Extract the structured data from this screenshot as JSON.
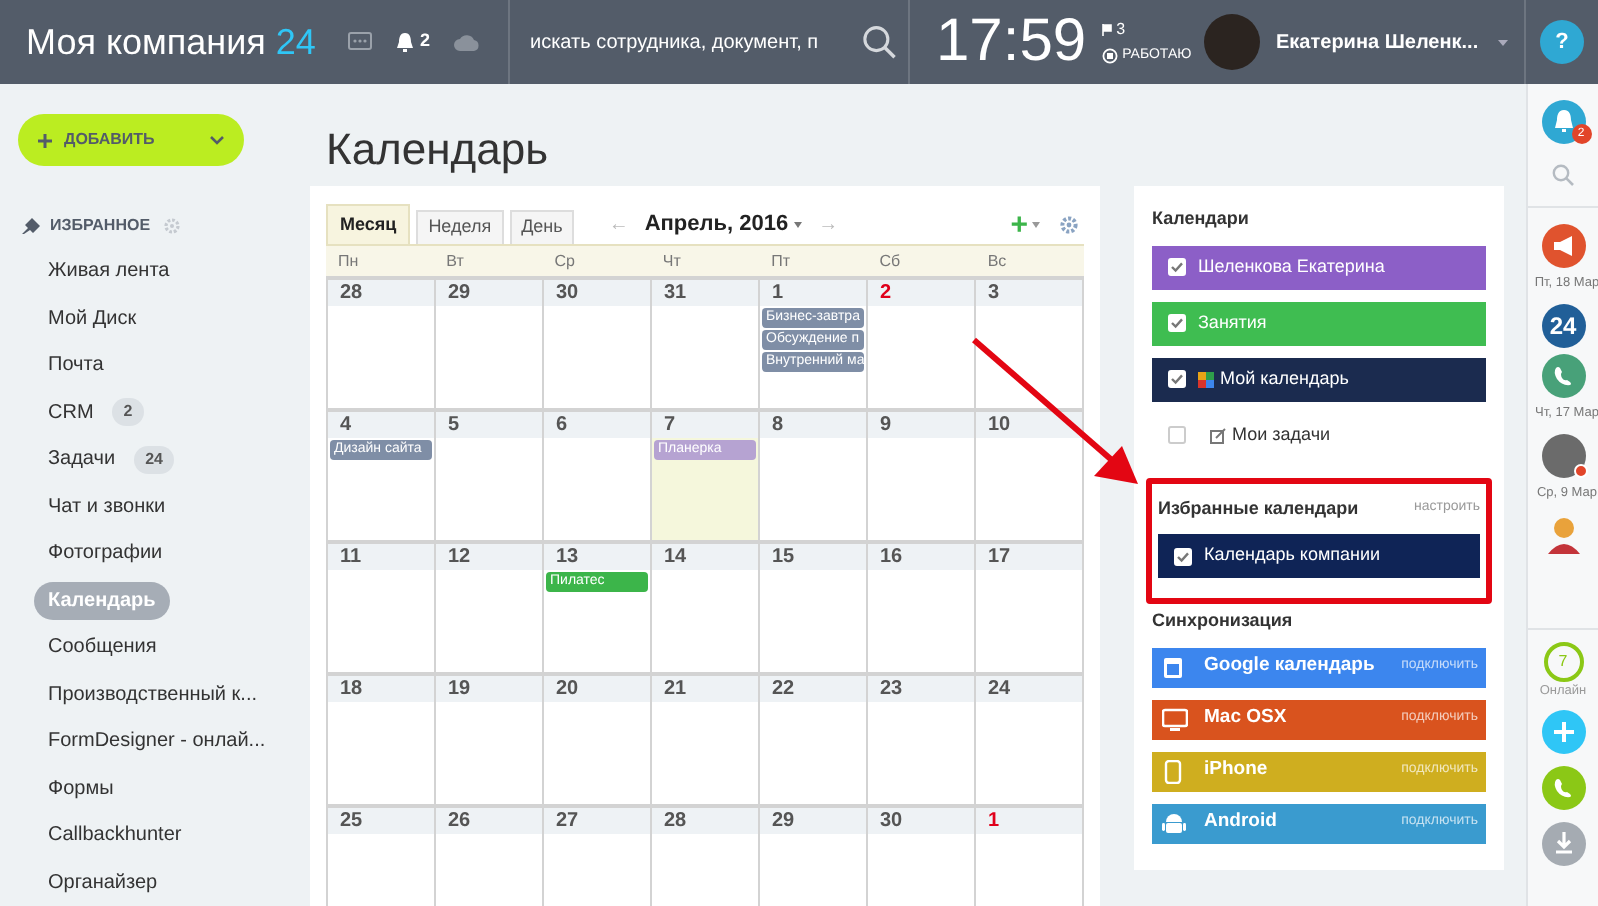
{
  "header": {
    "logo": "Моя компания",
    "logo_number": "24",
    "notifications": "2",
    "search": {
      "placeholder": "искать сотрудника, документ, п"
    },
    "clock": "17:59",
    "flags": "3",
    "status": "РАБОТАЮ",
    "user": "Екатерина Шеленк...",
    "help": "?"
  },
  "sidebar": {
    "add_button": "ДОБАВИТЬ",
    "section": "ИЗБРАННОЕ",
    "items": [
      {
        "label": "Живая лента",
        "selected": false
      },
      {
        "label": "Мой Диск",
        "selected": false
      },
      {
        "label": "Почта",
        "selected": false
      },
      {
        "label": "CRM",
        "badge": "2",
        "selected": false
      },
      {
        "label": "Задачи",
        "badge": "24",
        "selected": false
      },
      {
        "label": "Чат и звонки",
        "selected": false
      },
      {
        "label": "Фотографии",
        "selected": false
      },
      {
        "label": "Календарь",
        "selected": true
      },
      {
        "label": "Сообщения",
        "selected": false
      },
      {
        "label": "Производственный к...",
        "selected": false
      },
      {
        "label": "FormDesigner - онлай...",
        "selected": false
      },
      {
        "label": "Формы",
        "selected": false
      },
      {
        "label": "Callbackhunter",
        "selected": false
      },
      {
        "label": "Органайзер",
        "selected": false
      }
    ]
  },
  "page_title": "Календарь",
  "calendar": {
    "tabs": [
      {
        "label": "Месяц",
        "selected": true
      },
      {
        "label": "Неделя",
        "selected": false
      },
      {
        "label": "День",
        "selected": false
      }
    ],
    "prev": "←",
    "month": "Апрель, 2016",
    "next": "→",
    "add": "+",
    "weekdays": [
      "Пн",
      "Вт",
      "Ср",
      "Чт",
      "Пт",
      "Сб",
      "Вс"
    ],
    "weeks": [
      [
        {
          "day": "28",
          "red": false,
          "today": false
        },
        {
          "day": "29",
          "red": false,
          "today": false
        },
        {
          "day": "30",
          "red": false,
          "today": false
        },
        {
          "day": "31",
          "red": false,
          "today": false
        },
        {
          "day": "1",
          "red": false,
          "today": false,
          "events": [
            {
              "title": "Бизнес-завтра",
              "color": "#7f8ea6"
            },
            {
              "title": "Обсуждение п",
              "color": "#7f8ea6"
            },
            {
              "title": "Внутренний ма",
              "color": "#7f8ea6"
            }
          ]
        },
        {
          "day": "2",
          "red": true,
          "today": false
        },
        {
          "day": "3",
          "red": false,
          "today": false
        }
      ],
      [
        {
          "day": "4",
          "red": false,
          "today": false,
          "events": [
            {
              "title": "Дизайн сайта",
              "color": "#7f8ea6"
            }
          ]
        },
        {
          "day": "5",
          "red": false,
          "today": false
        },
        {
          "day": "6",
          "red": false,
          "today": false
        },
        {
          "day": "7",
          "red": false,
          "today": true,
          "events": [
            {
              "title": "Планерка",
              "color": "#b6a3d2"
            }
          ]
        },
        {
          "day": "8",
          "red": false,
          "today": false
        },
        {
          "day": "9",
          "red": false,
          "today": false
        },
        {
          "day": "10",
          "red": false,
          "today": false
        }
      ],
      [
        {
          "day": "11",
          "red": false,
          "today": false
        },
        {
          "day": "12",
          "red": false,
          "today": false
        },
        {
          "day": "13",
          "red": false,
          "today": false,
          "events": [
            {
              "title": "Пилатес",
              "color": "#3cb54a"
            }
          ]
        },
        {
          "day": "14",
          "red": false,
          "today": false
        },
        {
          "day": "15",
          "red": false,
          "today": false
        },
        {
          "day": "16",
          "red": false,
          "today": false
        },
        {
          "day": "17",
          "red": false,
          "today": false
        }
      ],
      [
        {
          "day": "18",
          "red": false,
          "today": false
        },
        {
          "day": "19",
          "red": false,
          "today": false
        },
        {
          "day": "20",
          "red": false,
          "today": false
        },
        {
          "day": "21",
          "red": false,
          "today": false
        },
        {
          "day": "22",
          "red": false,
          "today": false
        },
        {
          "day": "23",
          "red": false,
          "today": false
        },
        {
          "day": "24",
          "red": false,
          "today": false
        }
      ],
      [
        {
          "day": "25",
          "red": false,
          "today": false
        },
        {
          "day": "26",
          "red": false,
          "today": false
        },
        {
          "day": "27",
          "red": false,
          "today": false
        },
        {
          "day": "28",
          "red": false,
          "today": false
        },
        {
          "day": "29",
          "red": false,
          "today": false
        },
        {
          "day": "30",
          "red": false,
          "today": false
        },
        {
          "day": "1",
          "red": true,
          "today": false
        }
      ]
    ]
  },
  "calendars_panel": {
    "title": "Календари",
    "items": [
      {
        "kind": "colored",
        "label": "Шеленкова Екатерина",
        "color": "#8c5fc7",
        "checked": true
      },
      {
        "kind": "colored",
        "label": "Занятия",
        "color": "#3fbd51",
        "checked": true
      },
      {
        "kind": "personal",
        "label": "Мой календарь",
        "color": "#1b2b4f",
        "checked": true
      },
      {
        "kind": "tasks",
        "label": "Мои задачи",
        "checked": false
      }
    ],
    "favorites_title": "Избранные календари",
    "favorites_action": "настроить",
    "favorites": [
      {
        "kind": "colored",
        "label": "Календарь компании",
        "color": "#0f2456",
        "checked": true
      }
    ],
    "sync_title": "Синхронизация",
    "sync": [
      {
        "kind": "google",
        "label": "Google календарь",
        "action": "подключить",
        "color": "#3c86ee"
      },
      {
        "kind": "mac",
        "label": "Mac OSX",
        "action": "подключить",
        "color": "#d9531e"
      },
      {
        "kind": "iphone",
        "label": "iPhone",
        "action": "подключить",
        "color": "#cfae1f"
      },
      {
        "kind": "android",
        "label": "Android",
        "action": "подключить",
        "color": "#3a9bcf"
      }
    ]
  },
  "rail": [
    {
      "kind": "notifications",
      "badge": "2"
    },
    {
      "kind": "search"
    },
    {
      "kind": "announcement"
    },
    {
      "kind": "date",
      "label": "Пт, 18 Мар"
    },
    {
      "kind": "app",
      "label": "24"
    },
    {
      "kind": "call"
    },
    {
      "kind": "date",
      "label": "Чт, 17 Мар"
    },
    {
      "kind": "user"
    },
    {
      "kind": "date",
      "label": "Ср, 9 Мар"
    },
    {
      "kind": "user2"
    },
    {
      "kind": "online",
      "count": "7",
      "label": "Онлайн"
    },
    {
      "kind": "add"
    },
    {
      "kind": "phone"
    },
    {
      "kind": "download"
    }
  ]
}
